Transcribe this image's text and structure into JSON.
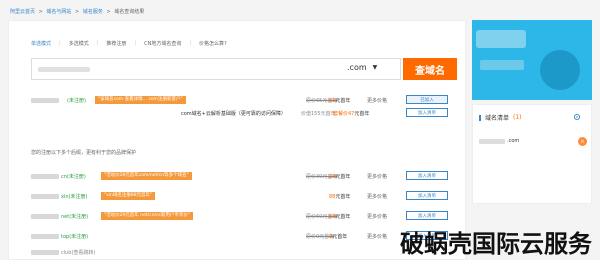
{
  "breadcrumb": {
    "items": [
      "阿里云首页",
      ">",
      "域名与网站",
      ">",
      "域名服务",
      ">",
      "域名查询结果"
    ]
  },
  "tabs": {
    "items": [
      {
        "label": "单选模式",
        "active": true
      },
      {
        "label": "多选模式",
        "active": false
      },
      {
        "label": "推荐注册",
        "active": false
      },
      {
        "label": "CN地方域名查询",
        "active": false
      },
      {
        "label": "价格怎么算?",
        "active": false
      }
    ]
  },
  "search": {
    "tld": ".com",
    "button_label": "查域名"
  },
  "results": [
    {
      "status": "(未注册)",
      "promo": "\"该域名com 查看详情... com注册新客户\"",
      "orig": "原价65元首年",
      "price": "55",
      "unit": "元首年",
      "more": "更多价格",
      "action": "已加入"
    },
    {
      "status": "",
      "promo": "",
      "desc": "com域名+云解析基础版（更可靠的访问保障）",
      "orig": "价值155元首年",
      "price": "套餐价47",
      "unit": "元首年",
      "more": "",
      "action": "加入清单"
    }
  ],
  "hint": "您的注册以下多个后缀，更有利于您的品牌保护",
  "suggestions": [
    {
      "status": "cn(未注册)",
      "promo": "\"活动价28元首年com/net/cn等多个域名\"",
      "orig": "原价39元首年",
      "price": "29",
      "unit": "元首年",
      "more": "更多价格",
      "action": "加入清单"
    },
    {
      "status": "xin(未注册)",
      "promo": "\"xin域名注册88元首年\"",
      "orig": "",
      "price": "88",
      "unit": "元首年",
      "more": "更多价格",
      "action": "加入清单"
    },
    {
      "status": "net(未注册)",
      "promo": "\"活动价29元首年 net/cn/cc新用户专享价\"",
      "orig": "原价69元首年",
      "price": "59",
      "unit": "元首年",
      "more": "更多价格",
      "action": "加入清单"
    },
    {
      "status": "top(未注册)",
      "promo": "",
      "orig": "原价9元首年",
      "price": "9",
      "unit": "元首年",
      "more": "更多价格",
      "action": "加入清单"
    },
    {
      "status": "club(查看跳转)",
      "promo": "",
      "orig": "",
      "price": "",
      "unit": "",
      "more": "",
      "action": ""
    }
  ],
  "domain_list": {
    "title": "域名清单",
    "count": "(1)",
    "item_tld": ".com"
  },
  "watermark": "破蜗壳国际云服务",
  "colors": {
    "accent": "#ff6a00",
    "link": "#3a86c8",
    "promo": "#f59a3c",
    "available": "#2a9d3a"
  }
}
